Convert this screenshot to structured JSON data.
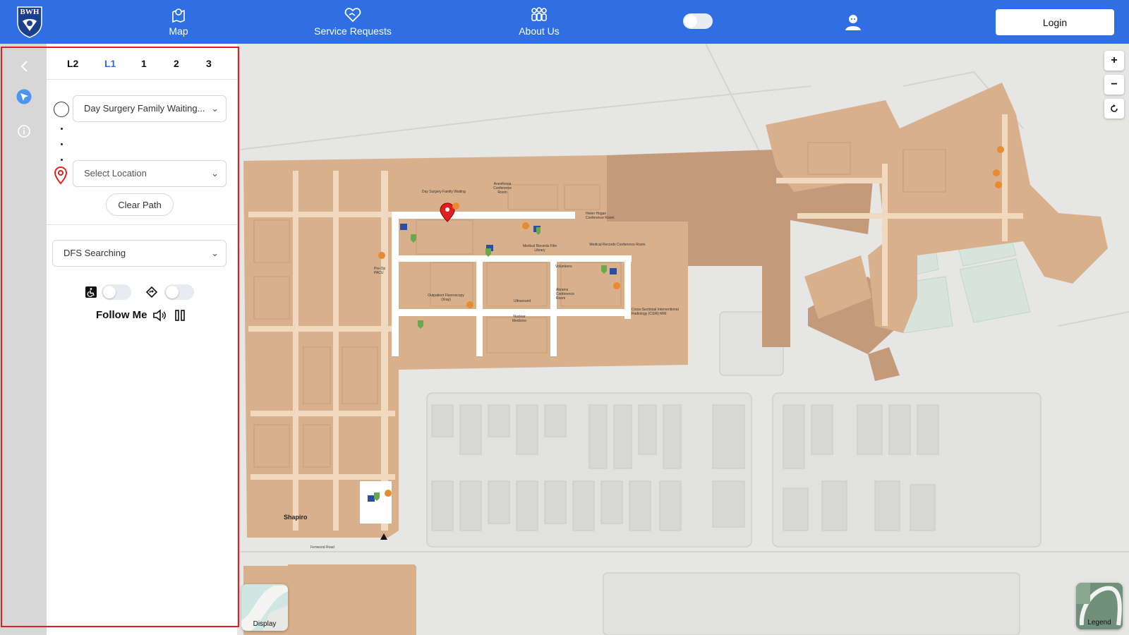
{
  "app": {
    "logo_text": "BWH"
  },
  "nav": {
    "map": "Map",
    "service_requests": "Service Requests",
    "about_us": "About Us",
    "login": "Login"
  },
  "floors": [
    "L2",
    "L1",
    "1",
    "2",
    "3"
  ],
  "active_floor": "L1",
  "pathfinding": {
    "start_value": "Day Surgery Family Waiting...",
    "end_placeholder": "Select Location",
    "clear_label": "Clear Path",
    "algorithm": "DFS Searching",
    "follow_me": "Follow Me",
    "accessible_enabled": false,
    "directions_enabled": false
  },
  "map_controls": {
    "zoom_in": "+",
    "zoom_out": "−",
    "display": "Display",
    "legend": "Legend"
  },
  "map_labels": {
    "shapiro": "Shapiro",
    "street": "Fenwood Road",
    "day_surgery": "Day Surgery Family Waiting",
    "anesthesia": "Anesthesia Conference Room",
    "helen_hogan": "Helen Hogan Conference Room",
    "med_records_film": "Medical Records Film Library",
    "med_records_conf": "Medical Records Conference Room",
    "volunteers": "Volunteers",
    "pre_op": "Pre-Op PACU",
    "fluoroscopy": "Outpatient Fluoroscopy (Xray)",
    "ultrasound": "Ultrasound",
    "nuclear": "Nuclear Medicine",
    "abrams": "Abrams Conference Room",
    "csir": "Cross-Sectional Interventional Radiology (CSIR) MRI"
  },
  "colors": {
    "brand": "#2f6fe3",
    "building": "#d9b08c",
    "corridor": "#f0d9bf",
    "highlight": "#e02020"
  },
  "icons": [
    "bwh-shield-icon",
    "map-pin-nav-icon",
    "heart-hand-icon",
    "group-icon",
    "user-icon",
    "chevron-left-icon",
    "navigation-arrow-icon",
    "info-icon",
    "location-pin-icon",
    "wheelchair-icon",
    "directions-icon",
    "speaker-icon",
    "pause-icon",
    "refresh-icon"
  ]
}
